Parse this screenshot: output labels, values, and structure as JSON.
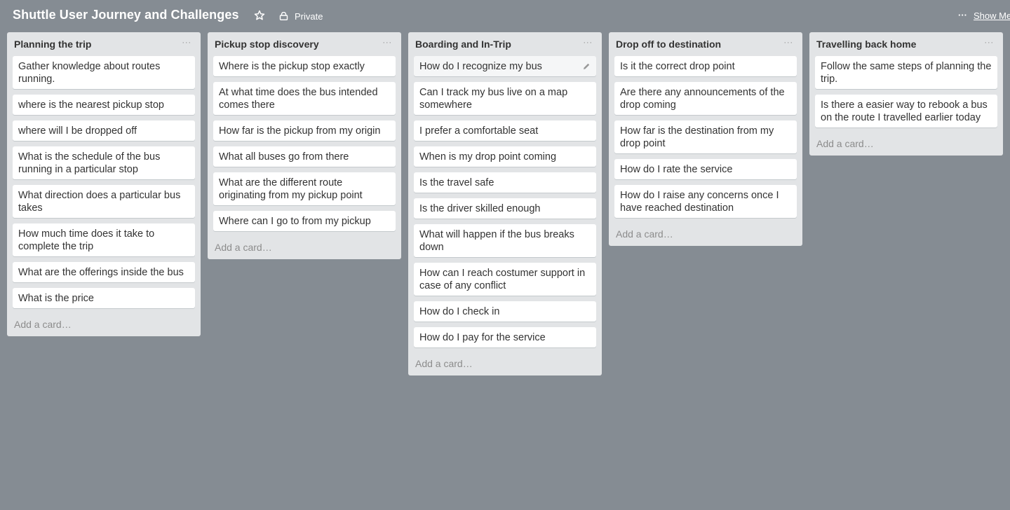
{
  "board": {
    "title": "Shuttle User Journey and Challenges",
    "privacy": "Private",
    "menu_dots": "···",
    "show_menu": "Show Menu"
  },
  "lists": [
    {
      "title": "Planning the trip",
      "menu": "···",
      "cards": [
        "Gather knowledge about routes running.",
        "where is the nearest pickup stop",
        "where will I be dropped off",
        "What is the schedule of the bus running in a particular stop",
        "What direction does a particular bus takes",
        "How much time does it take to complete the trip",
        "What are the offerings inside the bus",
        "What is the price"
      ],
      "add_card": "Add a card…"
    },
    {
      "title": "Pickup stop discovery",
      "menu": "···",
      "cards": [
        "Where is the pickup stop exactly",
        "At what time does the bus intended comes there",
        "How far is the pickup from my origin",
        "What all buses go from there",
        "What are the different route originating from my pickup point",
        "Where can I go to from my pickup"
      ],
      "add_card": "Add a card…"
    },
    {
      "title": "Boarding and In-Trip",
      "menu": "···",
      "cards": [
        "How do I recognize my bus",
        "Can I track my bus live on a map somewhere",
        "I prefer a comfortable seat",
        "When is my drop point coming",
        "Is the travel safe",
        "Is the driver skilled enough",
        "What will happen if the bus breaks down",
        "How can I reach costumer support in case of any conflict",
        "How do I check in",
        "How do I pay for the service"
      ],
      "add_card": "Add a card…"
    },
    {
      "title": "Drop off to destination",
      "menu": "···",
      "cards": [
        "Is it the correct drop point",
        "Are there any announcements of the drop coming",
        "How far is the destination from my drop point",
        "How do I rate the service",
        "How do I raise any concerns once I have reached destination"
      ],
      "add_card": "Add a card…"
    },
    {
      "title": "Travelling back home",
      "menu": "···",
      "cards": [
        "Follow the same steps of planning the trip.",
        "Is there a easier way to rebook a bus on the route I travelled earlier today"
      ],
      "add_card": "Add a card…"
    }
  ],
  "colors": {
    "board_background": "#858c93",
    "list_background": "#e2e4e6",
    "card_background": "#ffffff"
  }
}
